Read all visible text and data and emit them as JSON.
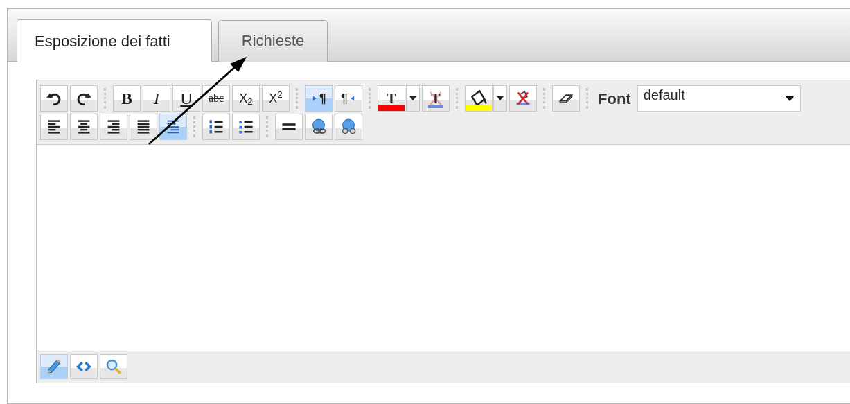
{
  "tabs": [
    {
      "label": "Esposizione dei fatti",
      "selected": true
    },
    {
      "label": "Richieste",
      "selected": false
    }
  ],
  "toolbar_rows": [
    [
      {
        "kind": "button",
        "selected": false
      },
      {
        "kind": "button",
        "selected": false
      },
      {
        "kind": "separator"
      },
      {
        "kind": "button",
        "label": "B",
        "selected": false
      },
      {
        "kind": "button",
        "label": "I",
        "selected": false
      },
      {
        "kind": "button",
        "label": "U",
        "selected": false
      },
      {
        "kind": "button",
        "label": "abc",
        "selected": false
      },
      {
        "kind": "button",
        "label": "X$_{2}$",
        "selected": false
      },
      {
        "kind": "button",
        "label": "X$^{2}$",
        "selected": false
      },
      {
        "kind": "separator"
      },
      {
        "kind": "button",
        "label": "¶",
        "selected": true
      },
      {
        "kind": "button",
        "label": "¶",
        "selected": false
      },
      {
        "kind": "separator"
      },
      {
        "kind": "button",
        "label": "T",
        "color": "#ff0000",
        "selected": false
      },
      {
        "kind": "dropdown"
      },
      {
        "kind": "button",
        "label": "T",
        "selected": false
      },
      {
        "kind": "separator"
      },
      {
        "kind": "button",
        "color": "#ffff00",
        "selected": false
      },
      {
        "kind": "dropdown"
      },
      {
        "kind": "button",
        "selected": false
      },
      {
        "kind": "separator"
      },
      {
        "kind": "button",
        "selected": false
      },
      {
        "kind": "separator"
      },
      {
        "kind": "font",
        "label": "Font",
        "value": "default"
      }
    ],
    [
      {
        "kind": "button",
        "selected": false
      },
      {
        "kind": "button",
        "selected": false
      },
      {
        "kind": "button",
        "selected": false
      },
      {
        "kind": "button",
        "selected": false
      },
      {
        "kind": "button",
        "selected": true
      },
      {
        "kind": "separator"
      },
      {
        "kind": "button",
        "selected": false
      },
      {
        "kind": "button",
        "selected": false
      },
      {
        "kind": "separator"
      },
      {
        "kind": "button",
        "selected": false
      },
      {
        "kind": "button",
        "selected": false
      },
      {
        "kind": "button",
        "selected": false
      }
    ]
  ],
  "mode_buttons": [
    {
      "selected": true
    },
    {
      "selected": false
    },
    {
      "selected": false
    }
  ]
}
